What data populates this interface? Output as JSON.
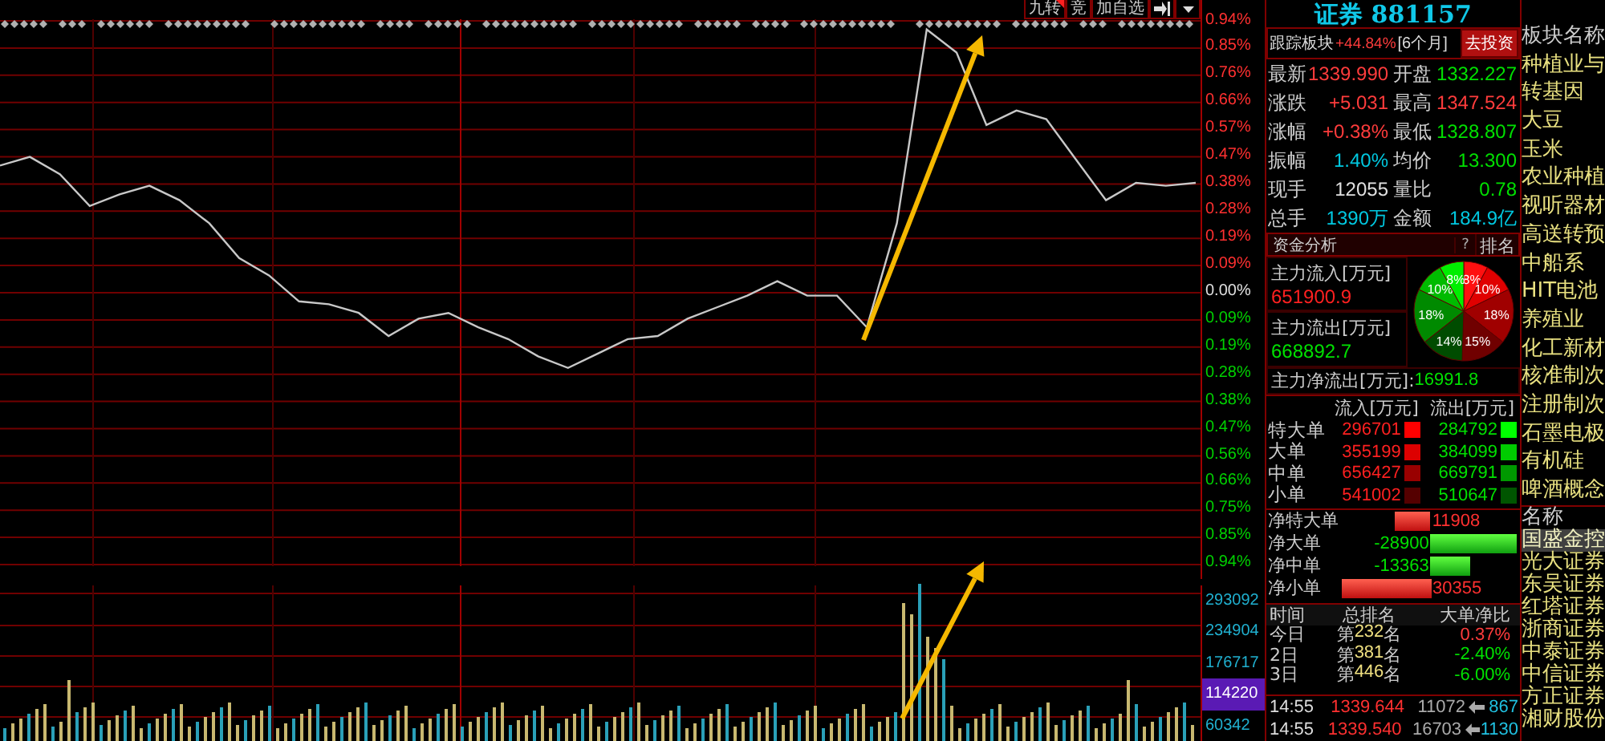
{
  "toolbar": {
    "buttons": [
      {
        "label": "九转",
        "flagged": true
      },
      {
        "label": "竞",
        "flagged": false
      },
      {
        "label": "加自选",
        "flagged": false
      }
    ]
  },
  "chart": {
    "chart_data": {
      "type": "line",
      "ylim": [
        -0.94,
        0.94
      ],
      "grid": true,
      "series": [
        {
          "color": "#c8c8c8",
          "values": [
            0.44,
            0.47,
            0.41,
            0.3,
            0.34,
            0.37,
            0.32,
            0.24,
            0.12,
            0.06,
            -0.03,
            -0.04,
            -0.07,
            -0.15,
            -0.09,
            -0.07,
            -0.12,
            -0.16,
            -0.22,
            -0.26,
            -0.21,
            -0.16,
            -0.15,
            -0.09,
            -0.05,
            -0.01,
            0.04,
            -0.01,
            -0.01,
            -0.12,
            0.24,
            0.91,
            0.83,
            0.58,
            0.63,
            0.6,
            0.46,
            0.32,
            0.38,
            0.37,
            0.38
          ]
        }
      ],
      "yticks": [
        {
          "value": 0.94,
          "label": "0.94%"
        },
        {
          "value": 0.85,
          "label": "0.85%"
        },
        {
          "value": 0.76,
          "label": "0.76%"
        },
        {
          "value": 0.66,
          "label": "0.66%"
        },
        {
          "value": 0.57,
          "label": "0.57%"
        },
        {
          "value": 0.47,
          "label": "0.47%"
        },
        {
          "value": 0.38,
          "label": "0.38%"
        },
        {
          "value": 0.28,
          "label": "0.28%"
        },
        {
          "value": 0.19,
          "label": "0.19%"
        },
        {
          "value": 0.09,
          "label": "0.09%"
        },
        {
          "value": 0,
          "label": "0.00%"
        },
        {
          "value": -0.09,
          "label": "0.09%"
        },
        {
          "value": -0.19,
          "label": "0.19%"
        },
        {
          "value": -0.28,
          "label": "0.28%"
        },
        {
          "value": -0.38,
          "label": "0.38%"
        },
        {
          "value": -0.47,
          "label": "0.47%"
        },
        {
          "value": -0.56,
          "label": "0.56%"
        },
        {
          "value": -0.66,
          "label": "0.66%"
        },
        {
          "value": -0.75,
          "label": "0.75%"
        },
        {
          "value": -0.85,
          "label": "0.85%"
        },
        {
          "value": -0.94,
          "label": "0.94%"
        }
      ]
    },
    "volume_axis": [
      {
        "label": "293092",
        "current": false
      },
      {
        "label": "234904",
        "current": false
      },
      {
        "label": "176717",
        "current": false
      },
      {
        "label": "114220",
        "current": true
      },
      {
        "label": "60342",
        "current": false
      }
    ]
  },
  "title": {
    "name": "证券",
    "code": "881157"
  },
  "tracking": {
    "label": "跟踪板块",
    "change": "+44.84%",
    "period": "[6个月]",
    "button": "去投资"
  },
  "quote": [
    {
      "label": "最新",
      "value": "1339.990",
      "color": "#ff3c3c"
    },
    {
      "label": "开盘",
      "value": "1332.227",
      "color": "#00e000"
    },
    {
      "label": "涨跌",
      "value": "+5.031",
      "color": "#ff3c3c"
    },
    {
      "label": "最高",
      "value": "1347.524",
      "color": "#ff3c3c"
    },
    {
      "label": "涨幅",
      "value": "+0.38%",
      "color": "#ff3c3c"
    },
    {
      "label": "最低",
      "value": "1328.807",
      "color": "#00e000"
    },
    {
      "label": "振幅",
      "value": "1.40%",
      "color": "#00c8e0"
    },
    {
      "label": "均价",
      "value": "13.300",
      "color": "#00e000"
    },
    {
      "label": "现手",
      "value": "12055",
      "color": "#e0e0e0"
    },
    {
      "label": "量比",
      "value": "0.78",
      "color": "#00e000"
    },
    {
      "label": "总手",
      "value": "1390万",
      "color": "#00c8e0"
    },
    {
      "label": "金额",
      "value": "184.9亿",
      "color": "#00c8e0"
    }
  ],
  "fund_analysis": {
    "title": "资金分析",
    "help": "?",
    "rank_button": "排名",
    "inflow_label": "主力流入[万元]",
    "inflow": "651900.9",
    "outflow_label": "主力流出[万元]",
    "outflow": "668892.7",
    "net_label": "主力净流出[万元]:",
    "net": "16991.8",
    "chart_data": {
      "type": "pie",
      "values": [
        8,
        10,
        18,
        15,
        14,
        18,
        10,
        8
      ],
      "value_labels": [
        "8%",
        "10%",
        "18%",
        "15%",
        "14%",
        "18%",
        "10%",
        "8%"
      ]
    }
  },
  "flow_table": {
    "columns": [
      "流入[万元]",
      "流出[万元]"
    ],
    "rows": [
      {
        "label": "特大单",
        "inflow": {
          "value": "296701",
          "color": "#ff0000"
        },
        "outflow": {
          "value": "284792",
          "color": "#00ff00"
        }
      },
      {
        "label": "大单",
        "inflow": {
          "value": "355199",
          "color": "#dd0000"
        },
        "outflow": {
          "value": "384099",
          "color": "#00cc00"
        }
      },
      {
        "label": "中单",
        "inflow": {
          "value": "656427",
          "color": "#990000"
        },
        "outflow": {
          "value": "669791",
          "color": "#009900"
        }
      },
      {
        "label": "小单",
        "inflow": {
          "value": "541002",
          "color": "#550000"
        },
        "outflow": {
          "value": "510647",
          "color": "#005500"
        }
      }
    ]
  },
  "net_orders": [
    {
      "label": "净特大单",
      "value": "11908",
      "kind": "inflow"
    },
    {
      "label": "净大单",
      "value": "-28900",
      "kind": "outflow"
    },
    {
      "label": "净中单",
      "value": "-13363",
      "kind": "outflow"
    },
    {
      "label": "净小单",
      "value": "30355",
      "kind": "inflow"
    }
  ],
  "ranking": {
    "columns": [
      "时间",
      "总排名",
      "大单净比"
    ],
    "rows": [
      {
        "period": "今日",
        "prefix": "第",
        "rank": "232",
        "suffix": "名",
        "ratio": "0.37%",
        "color": "#ff3c3c"
      },
      {
        "period": "2日",
        "prefix": "第",
        "rank": "381",
        "suffix": "名",
        "ratio": "-2.40%",
        "color": "#00e000"
      },
      {
        "period": "3日",
        "prefix": "第",
        "rank": "446",
        "suffix": "名",
        "ratio": "-6.00%",
        "color": "#00e000"
      }
    ]
  },
  "ticks": [
    {
      "time": "14:55",
      "price": "1339.644",
      "volume": "11072",
      "count": "867"
    },
    {
      "time": "14:55",
      "price": "1339.540",
      "volume": "16703",
      "count": "1130"
    }
  ],
  "sectors": {
    "header": "板块名称",
    "items": [
      "种植业与",
      "转基因",
      "大豆",
      "玉米",
      "农业种植",
      "视听器材",
      "高送转预",
      "中船系",
      "HIT电池",
      "养殖业",
      "化工新材",
      "核准制次",
      "注册制次",
      "石墨电极",
      "有机硅",
      "啤酒概念"
    ]
  },
  "stocks": {
    "header": "名称",
    "items": [
      {
        "name": "国盛金控",
        "selected": true
      },
      {
        "name": "光大证券",
        "selected": false
      },
      {
        "name": "东吴证券",
        "selected": false
      },
      {
        "name": "红塔证券",
        "selected": false
      },
      {
        "name": "浙商证券",
        "selected": false
      },
      {
        "name": "中泰证券",
        "selected": false
      },
      {
        "name": "中信证券",
        "selected": false
      },
      {
        "name": "方正证券",
        "selected": false
      },
      {
        "name": "湘财股份",
        "selected": false
      }
    ]
  }
}
